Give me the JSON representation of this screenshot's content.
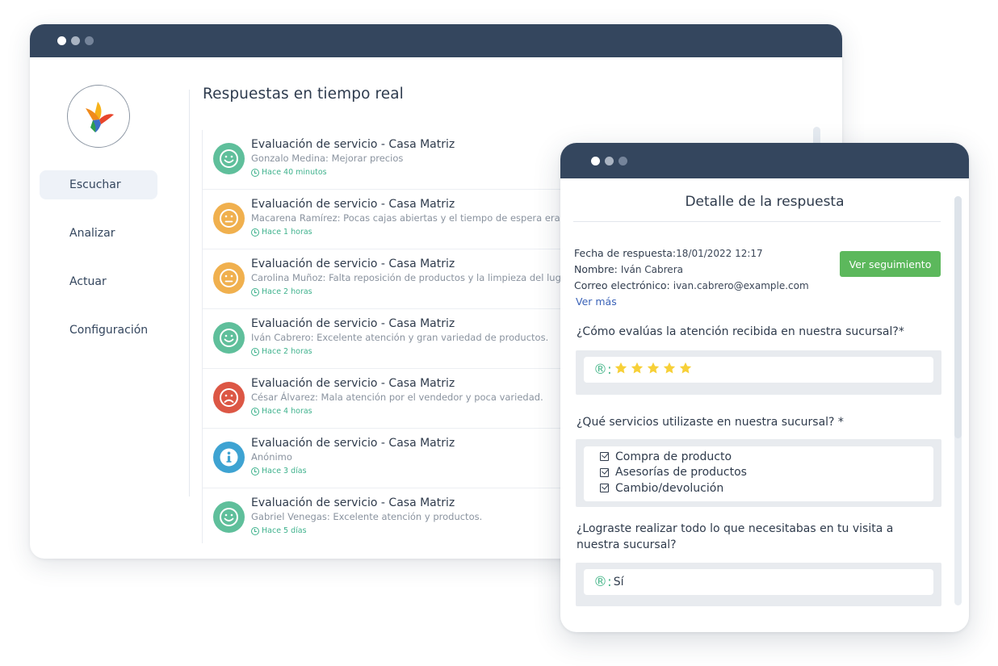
{
  "main": {
    "title": "Respuestas en tiempo real",
    "nav": [
      {
        "label": "Escuchar",
        "active": true
      },
      {
        "label": "Analizar",
        "active": false
      },
      {
        "label": "Actuar",
        "active": false
      },
      {
        "label": "Configuración",
        "active": false
      }
    ],
    "responses": [
      {
        "title": "Evaluación de servicio - Casa Matriz",
        "subtitle": "Gonzalo Medina: Mejorar precios",
        "time": "Hace 40 minutos",
        "sentiment": "happy",
        "color": "#5fbf9b"
      },
      {
        "title": "Evaluación de servicio - Casa Matriz",
        "subtitle": "Macarena Ramírez: Pocas cajas abiertas y el tiempo de espera era muy l",
        "time": "Hace 1 horas",
        "sentiment": "neutral",
        "color": "#f0b04e"
      },
      {
        "title": "Evaluación de servicio - Casa Matriz",
        "subtitle": "Carolina Muñoz: Falta reposición de productos y la limpieza del lugar.",
        "time": "Hace 2 horas",
        "sentiment": "neutral",
        "color": "#f0b04e"
      },
      {
        "title": "Evaluación de servicio - Casa Matriz",
        "subtitle": "Iván Cabrero: Excelente atención y gran variedad de productos.",
        "time": "Hace 2 horas",
        "sentiment": "happy",
        "color": "#5fbf9b"
      },
      {
        "title": "Evaluación de servicio - Casa Matriz",
        "subtitle": "César Álvarez: Mala atención por el vendedor y poca variedad.",
        "time": "Hace 4 horas",
        "sentiment": "sad",
        "color": "#dc5745"
      },
      {
        "title": "Evaluación de servicio - Casa Matriz",
        "subtitle": "Anónimo",
        "time": "Hace 3 días",
        "sentiment": "info",
        "color": "#3ea3d2"
      },
      {
        "title": "Evaluación de servicio - Casa Matriz",
        "subtitle": "Gabriel Venegas: Excelente atención y productos.",
        "time": "Hace 5 días",
        "sentiment": "happy",
        "color": "#5fbf9b"
      }
    ]
  },
  "detail": {
    "title": "Detalle de la respuesta",
    "date_label": "Fecha de respuesta:",
    "date_value": "18/01/2022 12:17",
    "name_label": "Nombre:",
    "name_value": "Iván Cabrera",
    "email_label": "Correo electrónico:",
    "email_value": "ivan.cabrero@example.com",
    "more_link": "Ver más",
    "follow_button": "Ver seguimiento",
    "answer_prefix": "®:",
    "q1": "¿Cómo evalúas la atención recibida en nuestra sucursal?*",
    "q1_rating": 5,
    "q1_rating_max": 5,
    "q2": "¿Qué servicios utilizaste en nuestra sucursal? *",
    "q2_options": [
      "Compra de producto",
      "Asesorías de productos",
      "Cambio/devolución"
    ],
    "q3_line1": "¿Lograste realizar todo lo que necesitabas en tu visita a",
    "q3_line2": "nuestra sucursal?",
    "q3_answer": "Sí",
    "star_color": "#f7d038"
  }
}
